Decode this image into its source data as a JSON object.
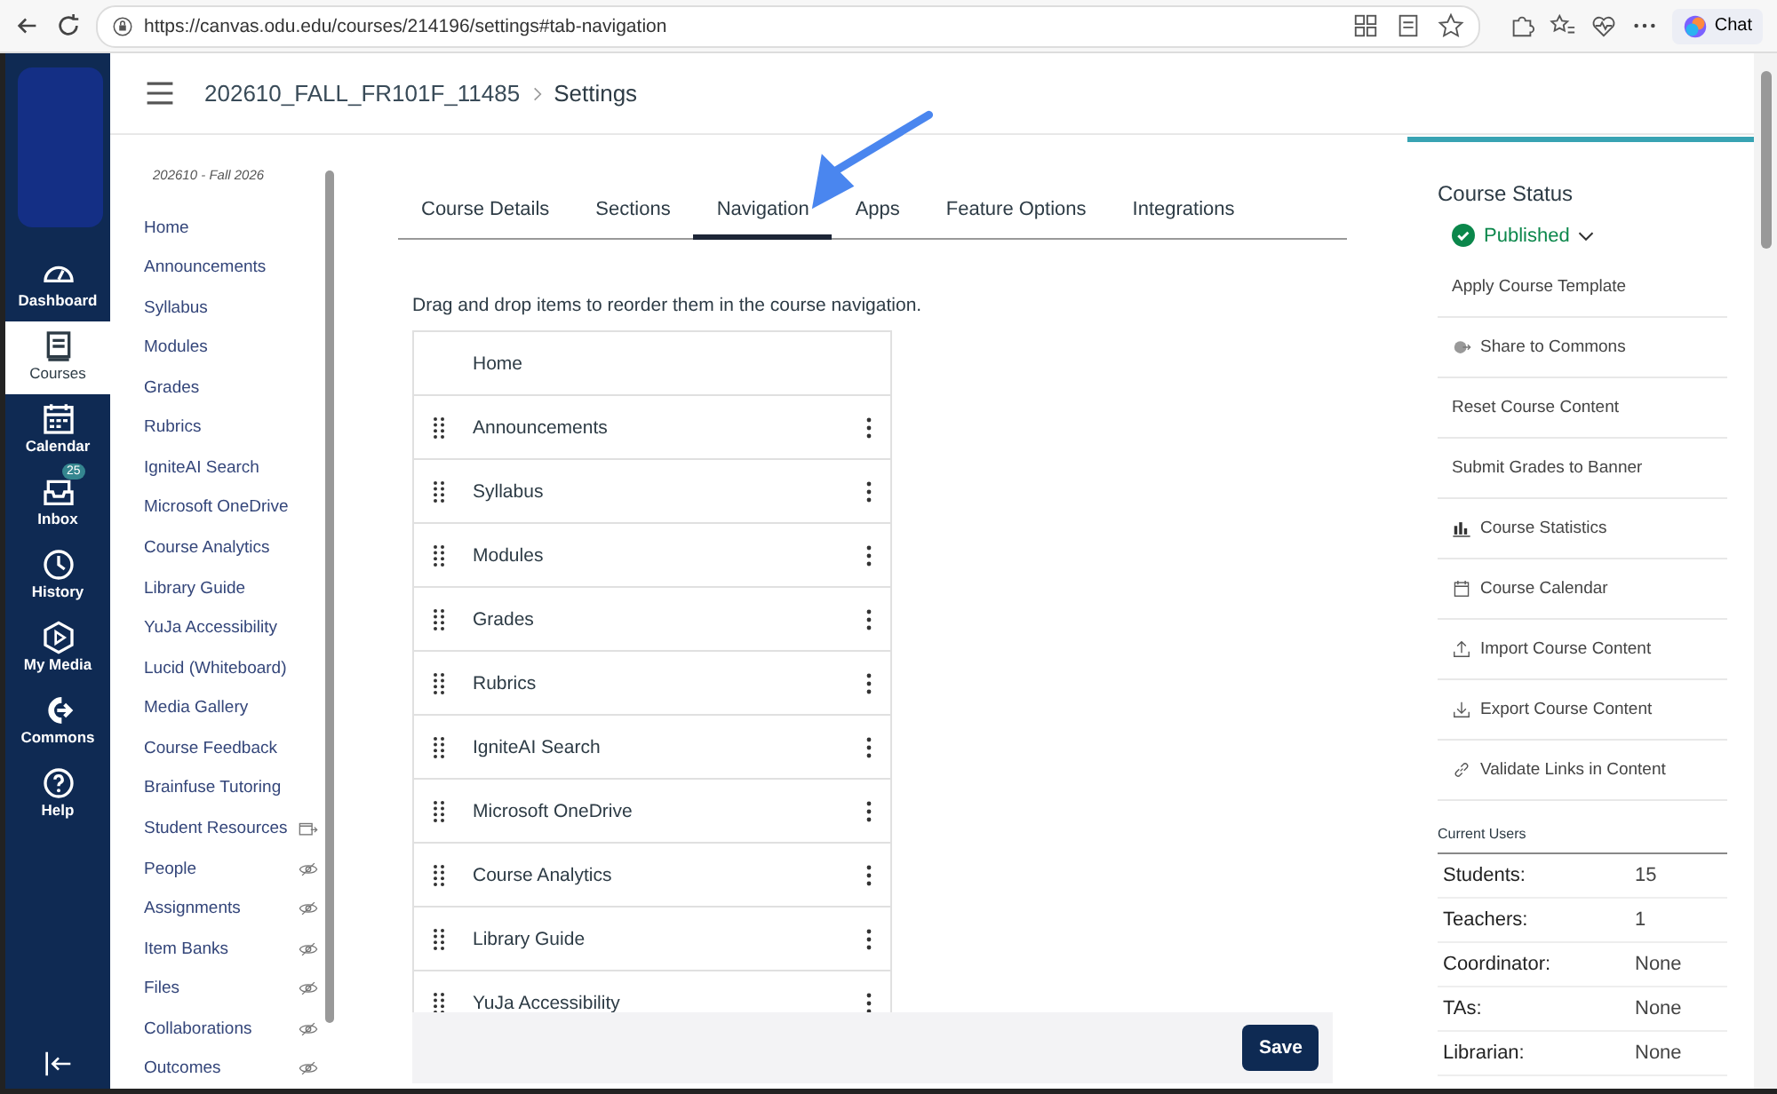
{
  "browser": {
    "url": "https://canvas.odu.edu/courses/214196/settings#tab-navigation",
    "chat_label": "Chat"
  },
  "global_nav": [
    {
      "label": "Dashboard",
      "kind": "dashboard",
      "selected": false
    },
    {
      "label": "Courses",
      "kind": "courses",
      "selected": true
    },
    {
      "label": "Calendar",
      "kind": "calendar",
      "selected": false
    },
    {
      "label": "Inbox",
      "kind": "inbox",
      "selected": false,
      "badge": "25"
    },
    {
      "label": "History",
      "kind": "history",
      "selected": false
    },
    {
      "label": "My Media",
      "kind": "media",
      "selected": false
    },
    {
      "label": "Commons",
      "kind": "commons",
      "selected": false
    },
    {
      "label": "Help",
      "kind": "help",
      "selected": false
    }
  ],
  "breadcrumb": [
    "202610_FALL_FR101F_11485",
    "Settings"
  ],
  "course_nav": {
    "term": "202610 - Fall 2026",
    "items": [
      {
        "label": "Home",
        "hidden": false,
        "external": false
      },
      {
        "label": "Announcements",
        "hidden": false,
        "external": false
      },
      {
        "label": "Syllabus",
        "hidden": false,
        "external": false
      },
      {
        "label": "Modules",
        "hidden": false,
        "external": false
      },
      {
        "label": "Grades",
        "hidden": false,
        "external": false
      },
      {
        "label": "Rubrics",
        "hidden": false,
        "external": false
      },
      {
        "label": "IgniteAI Search",
        "hidden": false,
        "external": false
      },
      {
        "label": "Microsoft OneDrive",
        "hidden": false,
        "external": false
      },
      {
        "label": "Course Analytics",
        "hidden": false,
        "external": false
      },
      {
        "label": "Library Guide",
        "hidden": false,
        "external": false
      },
      {
        "label": "YuJa Accessibility",
        "hidden": false,
        "external": false
      },
      {
        "label": "Lucid (Whiteboard)",
        "hidden": false,
        "external": false
      },
      {
        "label": "Media Gallery",
        "hidden": false,
        "external": false
      },
      {
        "label": "Course Feedback",
        "hidden": false,
        "external": false
      },
      {
        "label": "Brainfuse Tutoring",
        "hidden": false,
        "external": false
      },
      {
        "label": "Student Resources",
        "hidden": false,
        "external": true
      },
      {
        "label": "People",
        "hidden": true,
        "external": false
      },
      {
        "label": "Assignments",
        "hidden": true,
        "external": false
      },
      {
        "label": "Item Banks",
        "hidden": true,
        "external": false
      },
      {
        "label": "Files",
        "hidden": true,
        "external": false
      },
      {
        "label": "Collaborations",
        "hidden": true,
        "external": false
      },
      {
        "label": "Outcomes",
        "hidden": true,
        "external": false
      }
    ]
  },
  "tabs": [
    {
      "label": "Course Details",
      "selected": false
    },
    {
      "label": "Sections",
      "selected": false
    },
    {
      "label": "Navigation",
      "selected": true
    },
    {
      "label": "Apps",
      "selected": false
    },
    {
      "label": "Feature Options",
      "selected": false
    },
    {
      "label": "Integrations",
      "selected": false
    }
  ],
  "instructions": "Drag and drop items to reorder them in the course navigation.",
  "nav_table": [
    {
      "label": "Home",
      "kind": "fixed"
    },
    {
      "label": "Announcements",
      "kind": "draggable"
    },
    {
      "label": "Syllabus",
      "kind": "draggable"
    },
    {
      "label": "Modules",
      "kind": "draggable"
    },
    {
      "label": "Grades",
      "kind": "draggable"
    },
    {
      "label": "Rubrics",
      "kind": "draggable"
    },
    {
      "label": "IgniteAI Search",
      "kind": "draggable"
    },
    {
      "label": "Microsoft OneDrive",
      "kind": "draggable"
    },
    {
      "label": "Course Analytics",
      "kind": "draggable"
    },
    {
      "label": "Library Guide",
      "kind": "draggable"
    },
    {
      "label": "YuJa Accessibility",
      "kind": "draggable"
    }
  ],
  "save_label": "Save",
  "course_status": {
    "title": "Course Status",
    "status": "Published"
  },
  "actions": [
    {
      "label": "Apply Course Template",
      "kind": "plain"
    },
    {
      "label": "Share to Commons",
      "kind": "share"
    },
    {
      "label": "Reset Course Content",
      "kind": "plain"
    },
    {
      "label": "Submit Grades to Banner",
      "kind": "plain"
    },
    {
      "label": "Course Statistics",
      "kind": "stats"
    },
    {
      "label": "Course Calendar",
      "kind": "calendar"
    },
    {
      "label": "Import Course Content",
      "kind": "import"
    },
    {
      "label": "Export Course Content",
      "kind": "export"
    },
    {
      "label": "Validate Links in Content",
      "kind": "link"
    }
  ],
  "current_users": {
    "title": "Current Users",
    "rows": [
      {
        "role": "Students:",
        "count": "15"
      },
      {
        "role": "Teachers:",
        "count": "1"
      },
      {
        "role": "Coordinator:",
        "count": "None"
      },
      {
        "role": "TAs:",
        "count": "None"
      },
      {
        "role": "Librarian:",
        "count": "None"
      }
    ]
  }
}
